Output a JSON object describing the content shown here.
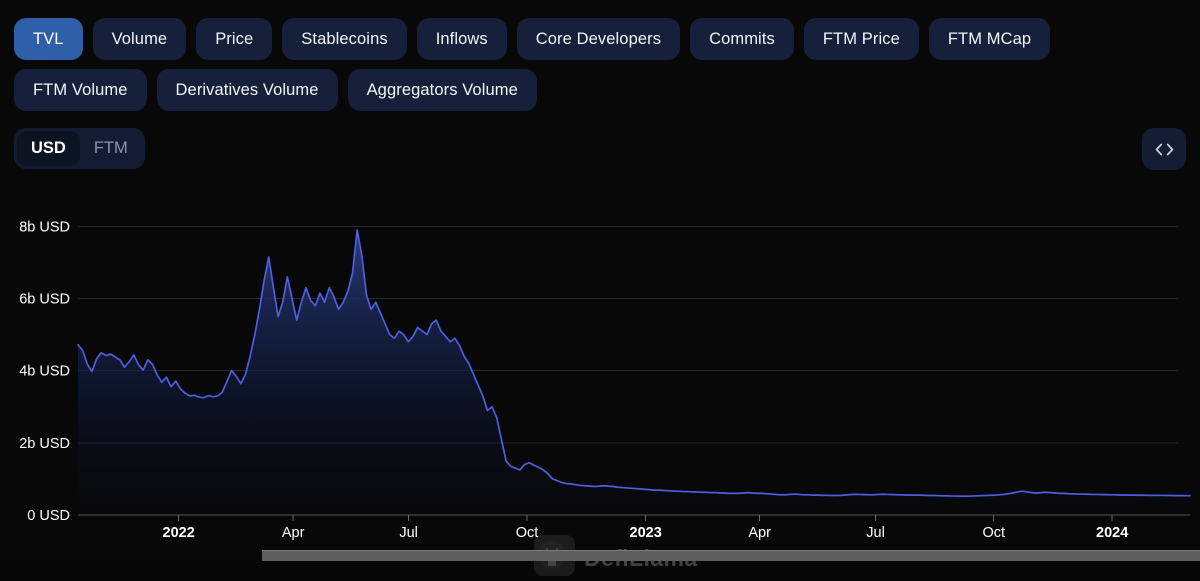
{
  "tabs": [
    {
      "label": "TVL",
      "active": true
    },
    {
      "label": "Volume",
      "active": false
    },
    {
      "label": "Price",
      "active": false
    },
    {
      "label": "Stablecoins",
      "active": false
    },
    {
      "label": "Inflows",
      "active": false
    },
    {
      "label": "Core Developers",
      "active": false
    },
    {
      "label": "Commits",
      "active": false
    },
    {
      "label": "FTM Price",
      "active": false
    },
    {
      "label": "FTM MCap",
      "active": false
    },
    {
      "label": "FTM Volume",
      "active": false
    },
    {
      "label": "Derivatives Volume",
      "active": false
    },
    {
      "label": "Aggregators Volume",
      "active": false
    }
  ],
  "currency_toggle": {
    "options": [
      "USD",
      "FTM"
    ],
    "selected": "USD"
  },
  "code_button": {
    "icon": "code-brackets-icon",
    "glyph": "<>"
  },
  "watermark": {
    "text": "DefiLlama",
    "logo": "llama-logo"
  },
  "colors": {
    "accent_active_tab": "#2e5fa8",
    "tab_background": "#16203a",
    "line": "#4d5fdd",
    "area_top": "#263a78",
    "background": "#080808",
    "gridline": "#2a2a2a",
    "brush": "#5e5e5e"
  },
  "chart_data": {
    "type": "area",
    "title": "",
    "subtitle": "",
    "xlabel": "",
    "ylabel": "",
    "grid": true,
    "legend": null,
    "unit": "USD",
    "y_ticks": [
      "0 USD",
      "2b USD",
      "4b USD",
      "6b USD",
      "8b USD"
    ],
    "y_tick_values": [
      0,
      2000000000,
      4000000000,
      6000000000,
      8000000000
    ],
    "ylim": [
      0,
      8400000000
    ],
    "x_ticks": [
      {
        "label": "2022",
        "bold": true,
        "pos": 0.0905
      },
      {
        "label": "Apr",
        "bold": false,
        "pos": 0.1935
      },
      {
        "label": "Jul",
        "bold": false,
        "pos": 0.2973
      },
      {
        "label": "Oct",
        "bold": false,
        "pos": 0.4038
      },
      {
        "label": "2023",
        "bold": true,
        "pos": 0.5105
      },
      {
        "label": "Apr",
        "bold": false,
        "pos": 0.613
      },
      {
        "label": "Jul",
        "bold": false,
        "pos": 0.7172
      },
      {
        "label": "Oct",
        "bold": false,
        "pos": 0.8235
      },
      {
        "label": "2024",
        "bold": true,
        "pos": 0.93
      }
    ],
    "x_range": [
      "2021-11-15",
      "2024-02-20"
    ],
    "series": [
      {
        "name": "TVL",
        "values": [
          4720,
          4560,
          4180,
          3980,
          4330,
          4500,
          4420,
          4460,
          4380,
          4300,
          4100,
          4250,
          4440,
          4160,
          4020,
          4300,
          4180,
          3890,
          3680,
          3820,
          3560,
          3710,
          3500,
          3380,
          3300,
          3320,
          3270,
          3250,
          3310,
          3280,
          3300,
          3400,
          3700,
          4000,
          3850,
          3640,
          3900,
          4400,
          5000,
          5700,
          6500,
          7150,
          6300,
          5500,
          5900,
          6600,
          6000,
          5400,
          5900,
          6300,
          5950,
          5800,
          6150,
          5900,
          6300,
          6050,
          5700,
          5900,
          6200,
          6700,
          7900,
          7200,
          6100,
          5700,
          5900,
          5600,
          5300,
          5000,
          4900,
          5100,
          5000,
          4800,
          4950,
          5200,
          5100,
          5000,
          5300,
          5400,
          5100,
          4950,
          4800,
          4900,
          4700,
          4400,
          4200,
          3900,
          3600,
          3300,
          2900,
          3000,
          2700,
          2100,
          1500,
          1350,
          1300,
          1250,
          1400,
          1450,
          1380,
          1320,
          1250,
          1150,
          1000,
          950,
          900,
          870,
          860,
          840,
          820,
          810,
          800,
          790,
          800,
          810,
          800,
          790,
          770,
          760,
          750,
          740,
          730,
          720,
          710,
          700,
          690,
          690,
          680,
          670,
          660,
          660,
          650,
          650,
          640,
          640,
          630,
          630,
          620,
          620,
          610,
          610,
          600,
          600,
          600,
          610,
          620,
          610,
          600,
          600,
          590,
          580,
          570,
          560,
          560,
          570,
          580,
          570,
          560,
          560,
          550,
          550,
          545,
          545,
          540,
          540,
          545,
          555,
          565,
          575,
          570,
          565,
          560,
          560,
          570,
          575,
          570,
          565,
          560,
          560,
          555,
          555,
          550,
          550,
          545,
          540,
          540,
          535,
          530,
          530,
          525,
          525,
          520,
          520,
          525,
          530,
          535,
          540,
          545,
          550,
          560,
          570,
          590,
          610,
          640,
          660,
          640,
          620,
          610,
          620,
          630,
          620,
          610,
          600,
          600,
          590,
          585,
          580,
          580,
          575,
          570,
          570,
          565,
          565,
          560,
          560,
          555,
          555,
          550,
          550,
          548,
          548,
          545,
          545,
          545,
          542,
          540,
          540,
          538,
          538,
          535,
          535
        ]
      }
    ]
  }
}
